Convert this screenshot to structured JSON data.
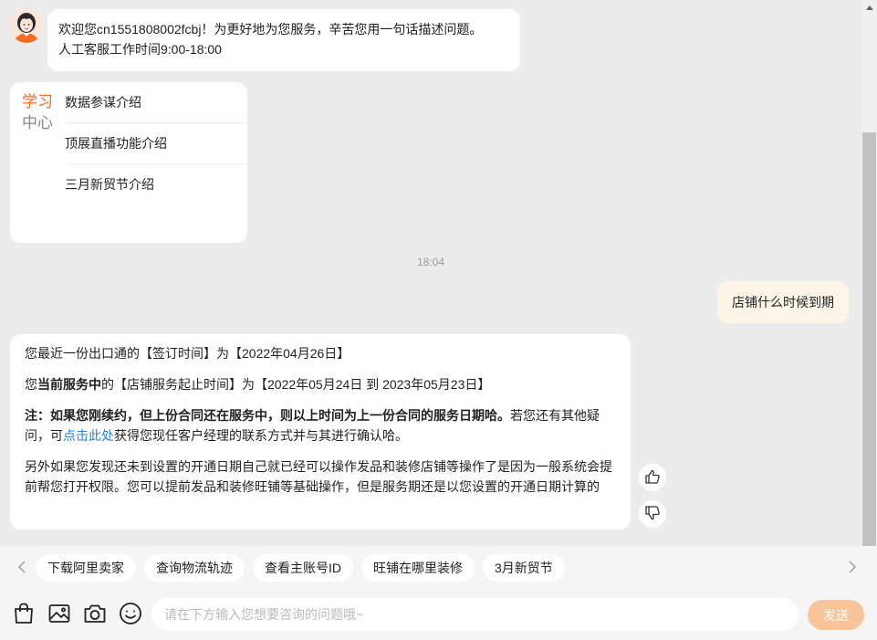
{
  "welcome": {
    "line1": "欢迎您cn1551808002fcbj！为更好地为您服务，辛苦您用一句话描述问题。",
    "line2": "人工客服工作时间9:00-18:00"
  },
  "study_center": {
    "title_part1": "学习",
    "title_part2": "中心",
    "items": [
      {
        "label": "数据参谋介绍"
      },
      {
        "label": "顶展直播功能介绍"
      },
      {
        "label": "三月新贸节介绍"
      }
    ]
  },
  "timestamp": "18:04",
  "user_message": "店铺什么时候到期",
  "answer": {
    "p1": "您最近一份出口通的【签订时间】为【2022年04月26日】",
    "p2_pre": "您",
    "p2_bold": "当前服务中",
    "p2_post": "的【店铺服务起止时间】为【2022年05月24日 到 2023年05月23日】",
    "p3_bold": "注：如果您刚续约，但上份合同还在服务中，则以上时间为上一份合同的服务日期哈。",
    "p3_mid": "若您还有其他疑问，可",
    "p3_link": "点击此处",
    "p3_post": "获得您现任客户经理的联系方式并与其进行确认哈。",
    "p4": "另外如果您发现还未到设置的开通日期自己就已经可以操作发品和装修店铺等操作了是因为一般系统会提前帮您打开权限。您可以提前发品和装修旺铺等基础操作，但是服务期还是以您设置的开通日期计算的"
  },
  "quick_replies": [
    "下载阿里卖家",
    "查询物流轨迹",
    "查看主账号ID",
    "旺铺在哪里装修",
    "3月新贸节"
  ],
  "input": {
    "placeholder": "请在下方输入您想要咨询的问题哦~",
    "value": ""
  },
  "send_label": "发送",
  "icons": {
    "bag": "shopping-bag-icon",
    "image": "image-icon",
    "camera": "camera-icon",
    "emoji": "smiley-icon",
    "like": "thumbs-up-icon",
    "dislike": "thumbs-down-icon"
  },
  "colors": {
    "accent": "#ff6a21",
    "send": "#f9c49a",
    "user_bubble": "#fdf6e8",
    "link": "#2a7fe0"
  }
}
